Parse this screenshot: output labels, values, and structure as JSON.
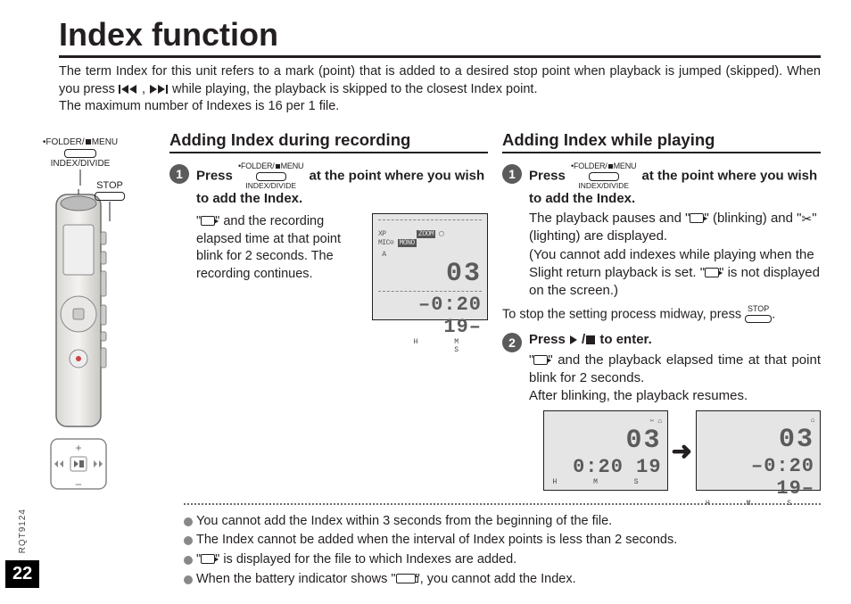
{
  "title": "Index function",
  "intro_a": "The term Index for this unit refers to a mark (point) that is added to a desired stop point when playback is jumped (skipped). When you press ",
  "intro_b": " while playing,  the playback is skipped to the closest Index point.",
  "intro_c": "The maximum number of Indexes is 16 per 1 file.",
  "left": {
    "folder_menu_top": "•FOLDER/",
    "folder_menu_top2": "MENU",
    "index_divide": "INDEX/DIVIDE",
    "stop": "STOP"
  },
  "btn": {
    "folder_menu": "•FOLDER/",
    "menu_suffix": "MENU",
    "index_divide": "INDEX/DIVIDE",
    "stop": "STOP"
  },
  "col1": {
    "heading": "Adding Index during recording",
    "step1_a": "Press ",
    "step1_b": " at the point where you wish to add the Index.",
    "desc1_a": "\"",
    "desc1_b": "\" and the recording elapsed time at that point blink for 2 seconds. The recording continues.",
    "lcd": {
      "top_row": "XP      ZOOM ⌂",
      "mic_row": "MIC⊙ MONO",
      "file_no": "03",
      "time": "0:20 19",
      "hms": "HMS"
    }
  },
  "col2": {
    "heading": "Adding Index while playing",
    "step1_a": "Press ",
    "step1_b": " at the point where you wish to add the Index.",
    "desc1_a": "The playback pauses and \"",
    "desc1_b": "\" (blinking) and \"",
    "desc1_c": "\" (lighting) are displayed.",
    "desc1_d": "(You cannot add indexes while playing when the Slight return playback is set. \"",
    "desc1_e": "\" is not displayed on the screen.)",
    "midway_a": "To stop the setting process midway, press ",
    "midway_b": ".",
    "step2_a": "Press ",
    "step2_b": " to enter.",
    "desc2_a": "\"",
    "desc2_b": "\" and the playback elapsed time at that point blink for 2 seconds.",
    "desc2_c": "After blinking, the playback resumes.",
    "lcd_file": "03",
    "lcd_time": "0:20 19",
    "lcd_hms": "HMS"
  },
  "notes": {
    "n1": "You cannot add the Index within 3 seconds from the beginning of the file.",
    "n2": "The Index cannot be added when the interval of Index points is less than 2 seconds.",
    "n3_a": "\"",
    "n3_b": "\" is displayed for the file to which Indexes are added.",
    "n4_a": "When the battery indicator shows \"",
    "n4_b": "\", you cannot add the Index."
  },
  "side": {
    "rqt": "RQT9124",
    "page": "22"
  }
}
